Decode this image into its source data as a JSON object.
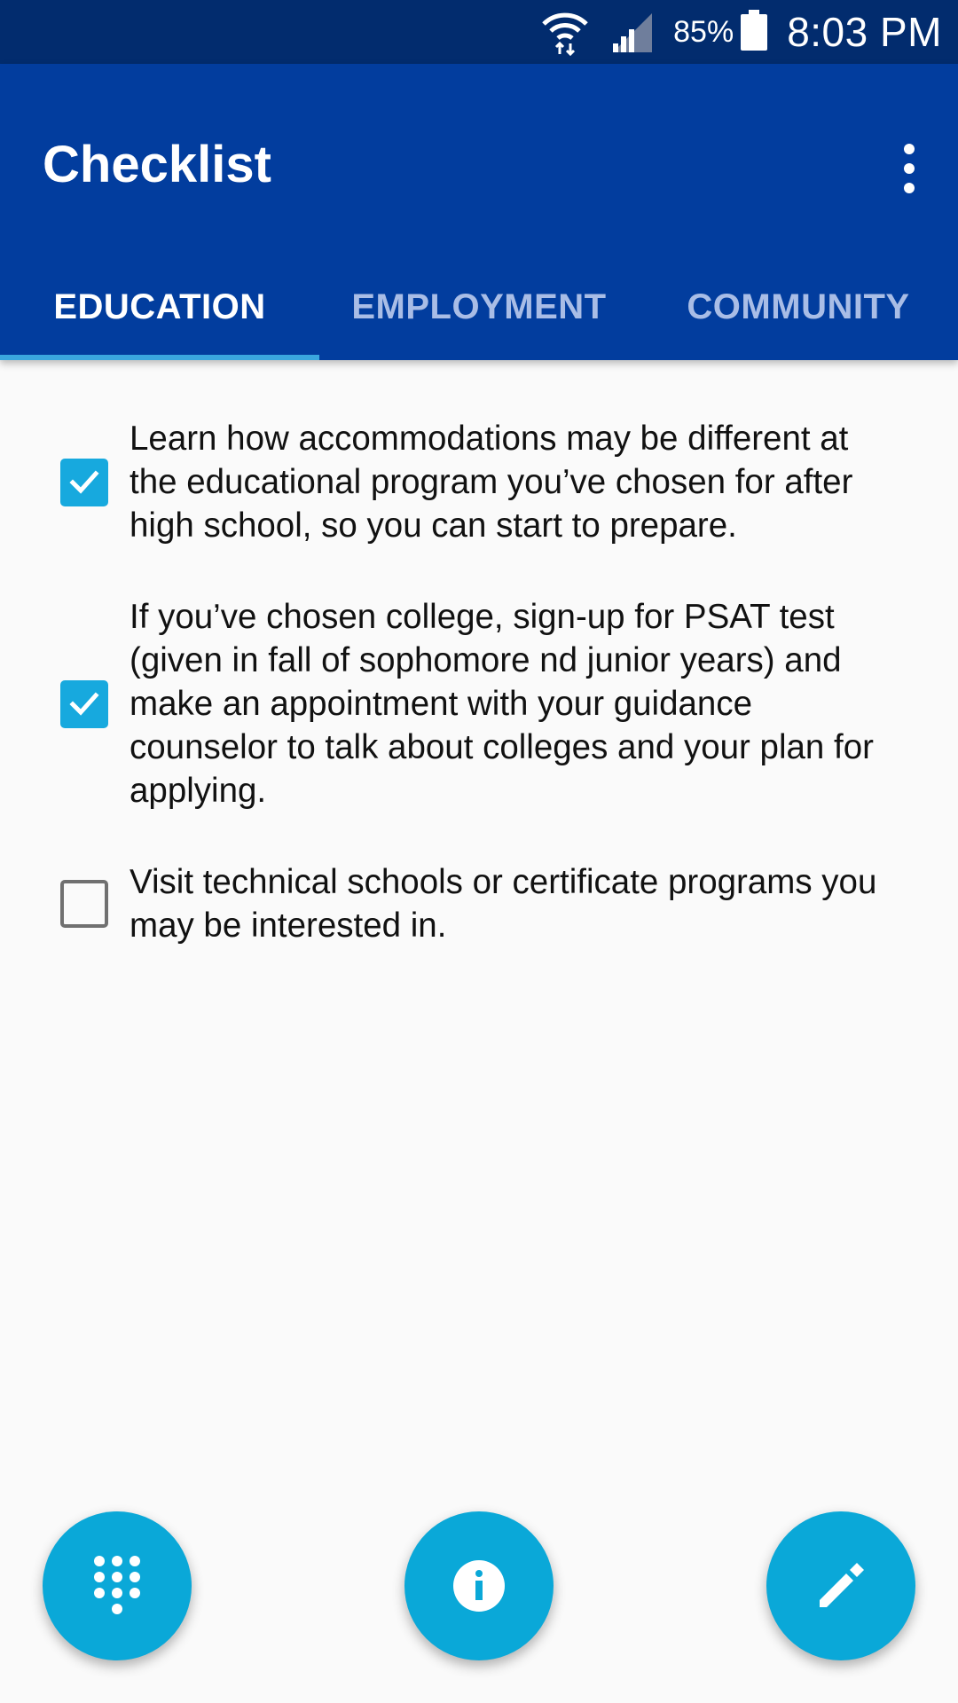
{
  "status_bar": {
    "battery": "85%",
    "time": "8:03 PM"
  },
  "app_bar": {
    "title": "Checklist"
  },
  "tabs": [
    {
      "label": "EDUCATION",
      "active": true
    },
    {
      "label": "EMPLOYMENT",
      "active": false
    },
    {
      "label": "COMMUNITY",
      "active": false
    }
  ],
  "checklist": [
    {
      "checked": true,
      "text": "Learn how accommodations may be different at the educational program you’ve chosen for after high school, so you can start to prepare."
    },
    {
      "checked": true,
      "text": "If you’ve chosen college, sign-up for PSAT test (given in fall of sophomore nd junior years) and make an appointment with your guidance counselor to talk about colleges and your plan for applying."
    },
    {
      "checked": false,
      "text": "Visit technical schools or certificate programs you may be interested in."
    }
  ],
  "fabs": [
    {
      "icon": "dialpad-icon"
    },
    {
      "icon": "info-icon"
    },
    {
      "icon": "edit-icon"
    }
  ],
  "colors": {
    "status_bar": "#022c6e",
    "app_bar": "#023d9e",
    "accent": "#17a9de",
    "fab": "#0aa8d8"
  }
}
